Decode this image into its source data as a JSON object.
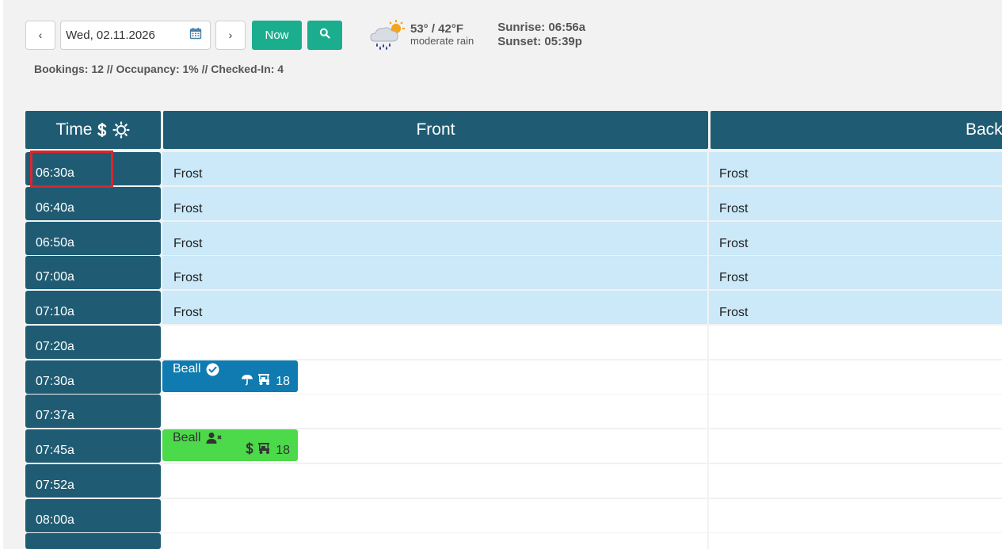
{
  "toolbar": {
    "prev_label": "‹",
    "date_value": "Wed, 02.11.2026",
    "next_label": "›",
    "now_label": "Now"
  },
  "weather": {
    "temps": "53° / 42°F",
    "condition": "moderate rain",
    "sunrise": "Sunrise: 06:56a",
    "sunset": "Sunset: 05:39p"
  },
  "stats": "Bookings: 12 // Occupancy: 1% // Checked-In: 4",
  "columns": {
    "time": "Time",
    "front": "Front",
    "back": "Back"
  },
  "rows": [
    {
      "time": "06:30a",
      "front": "Frost",
      "back": "Frost"
    },
    {
      "time": "06:40a",
      "front": "Frost",
      "back": "Frost"
    },
    {
      "time": "06:50a",
      "front": "Frost",
      "back": "Frost"
    },
    {
      "time": "07:00a",
      "front": "Frost",
      "back": "Frost"
    },
    {
      "time": "07:10a",
      "front": "Frost",
      "back": "Frost"
    },
    {
      "time": "07:20a",
      "front": "",
      "back": ""
    },
    {
      "time": "07:30a",
      "front": "",
      "back": ""
    },
    {
      "time": "07:37a",
      "front": "",
      "back": ""
    },
    {
      "time": "07:45a",
      "front": "",
      "back": ""
    },
    {
      "time": "07:52a",
      "front": "",
      "back": ""
    },
    {
      "time": "08:00a",
      "front": "",
      "back": ""
    },
    {
      "time": "",
      "front": "",
      "back": ""
    }
  ],
  "bookings": [
    {
      "name": "Beall",
      "holes": "18",
      "status": "checked-in",
      "color": "#0f7bb0"
    },
    {
      "name": "Beall",
      "holes": "18",
      "status": "not-checked-in",
      "color": "#4cd94a"
    }
  ],
  "colors": {
    "header": "#1f5c73",
    "frost": "#cbe9f9",
    "accent": "#1bae8e",
    "highlight": "#d9262c"
  }
}
